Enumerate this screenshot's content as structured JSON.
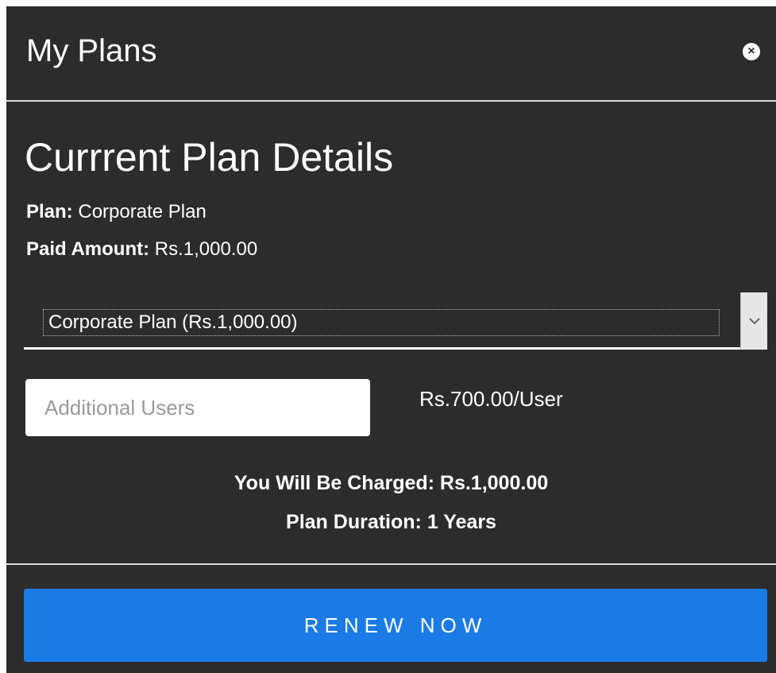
{
  "modal": {
    "title": "My Plans",
    "close_icon": "close-icon"
  },
  "current_plan": {
    "heading": "Currrent Plan Details",
    "plan_label": "Plan:",
    "plan_value": "Corporate Plan",
    "paid_label": "Paid Amount:",
    "paid_value": "Rs.1,000.00"
  },
  "plan_select": {
    "selected": "Corporate Plan (Rs.1,000.00)",
    "arrow_icon": "chevron-down-icon"
  },
  "additional_users": {
    "placeholder": "Additional Users",
    "value": "",
    "price_per_user": "Rs.700.00/User"
  },
  "summary": {
    "charge_text": "You Will Be Charged: Rs.1,000.00",
    "duration_text": "Plan Duration: 1 Years"
  },
  "actions": {
    "renew_label": "RENEW NOW"
  },
  "colors": {
    "modal_background": "#2c2c2c",
    "accent_button": "#1b7be6",
    "divider": "#d9d9d9"
  }
}
